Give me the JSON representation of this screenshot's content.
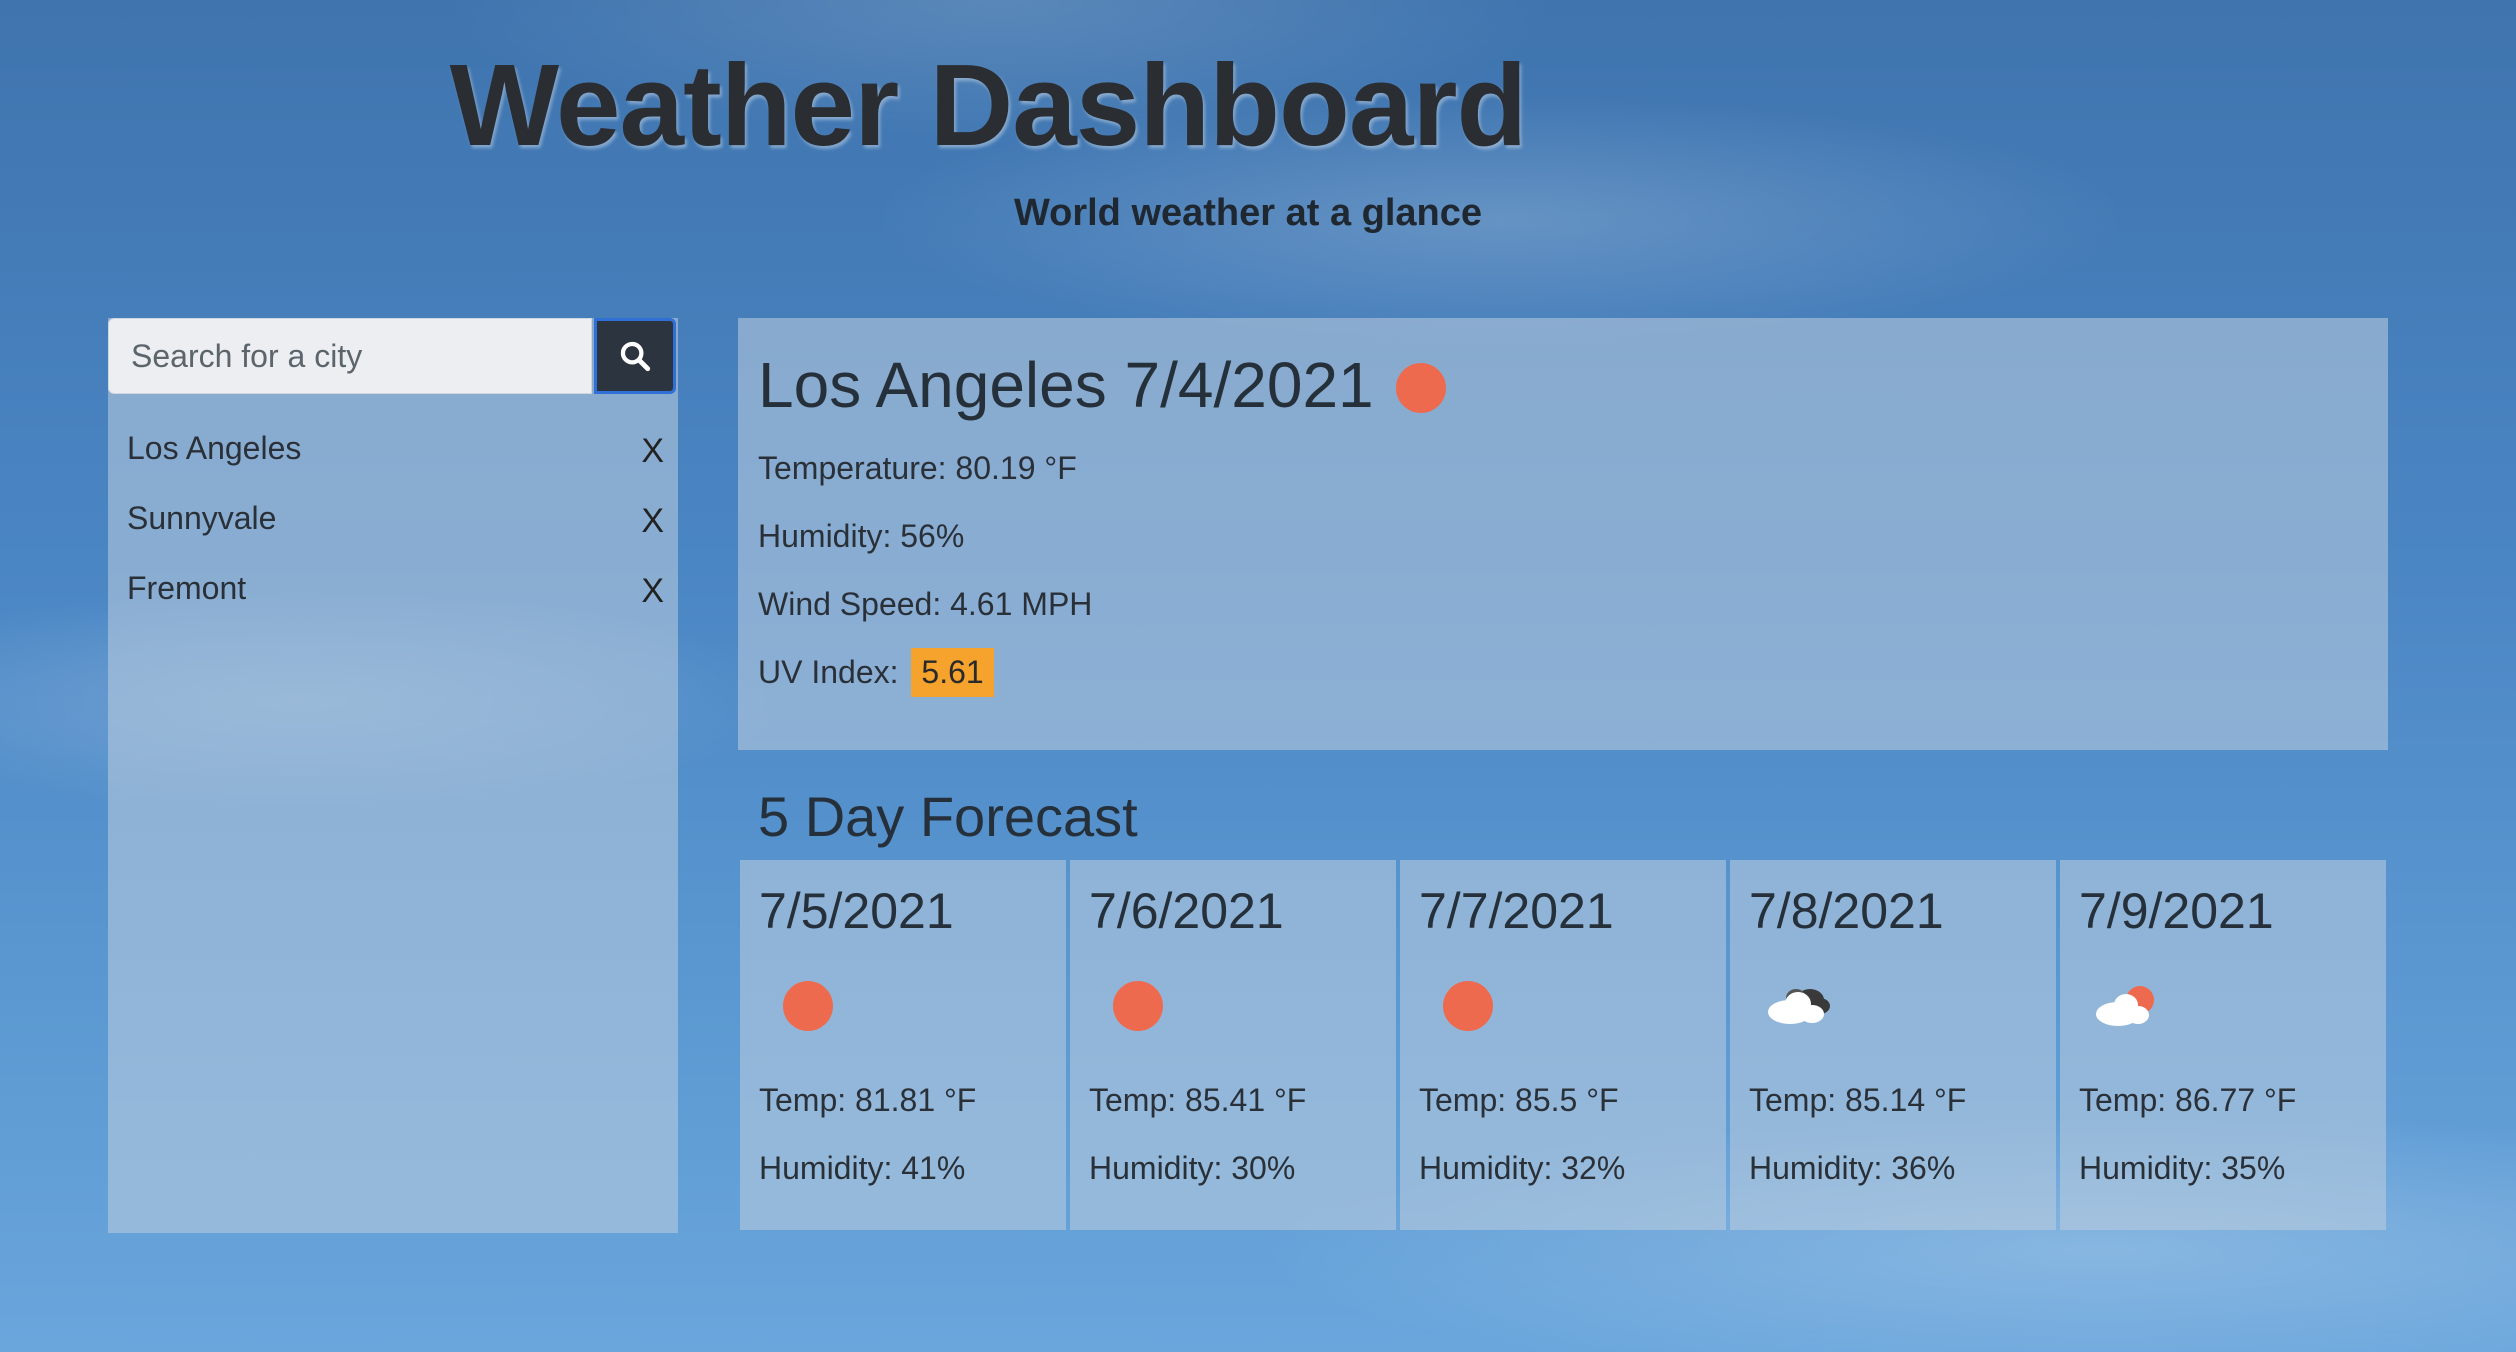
{
  "header": {
    "title": "Weather Dashboard",
    "subtitle": "World weather at a glance"
  },
  "search": {
    "placeholder": "Search for a city",
    "value": "",
    "button_icon": "search-icon"
  },
  "history": [
    {
      "city": "Los Angeles",
      "remove": "X"
    },
    {
      "city": "Sunnyvale",
      "remove": "X"
    },
    {
      "city": "Fremont",
      "remove": "X"
    }
  ],
  "current": {
    "heading": "Los Angeles 7/4/2021",
    "icon": "clear-sky-sun-icon",
    "temperature": "Temperature: 80.19 °F",
    "humidity": "Humidity: 56%",
    "wind": "Wind Speed: 4.61 MPH",
    "uv_label": "UV Index:",
    "uv_value": "5.61",
    "uv_color": "#f5a32c"
  },
  "forecast": {
    "heading": "5 Day Forecast",
    "days": [
      {
        "date": "7/5/2021",
        "icon": "sun-icon",
        "temp": "Temp: 81.81 °F",
        "humidity": "Humidity: 41%"
      },
      {
        "date": "7/6/2021",
        "icon": "sun-icon",
        "temp": "Temp: 85.41 °F",
        "humidity": "Humidity: 30%"
      },
      {
        "date": "7/7/2021",
        "icon": "sun-icon",
        "temp": "Temp: 85.5 °F",
        "humidity": "Humidity: 32%"
      },
      {
        "date": "7/8/2021",
        "icon": "broken-clouds-icon",
        "temp": "Temp: 85.14 °F",
        "humidity": "Humidity: 36%"
      },
      {
        "date": "7/9/2021",
        "icon": "few-clouds-icon",
        "temp": "Temp: 86.77 °F",
        "humidity": "Humidity: 35%"
      }
    ]
  },
  "colors": {
    "sun": "#ee6a4e",
    "search_button": "#2c3440",
    "uv_moderate": "#f5a32c"
  }
}
